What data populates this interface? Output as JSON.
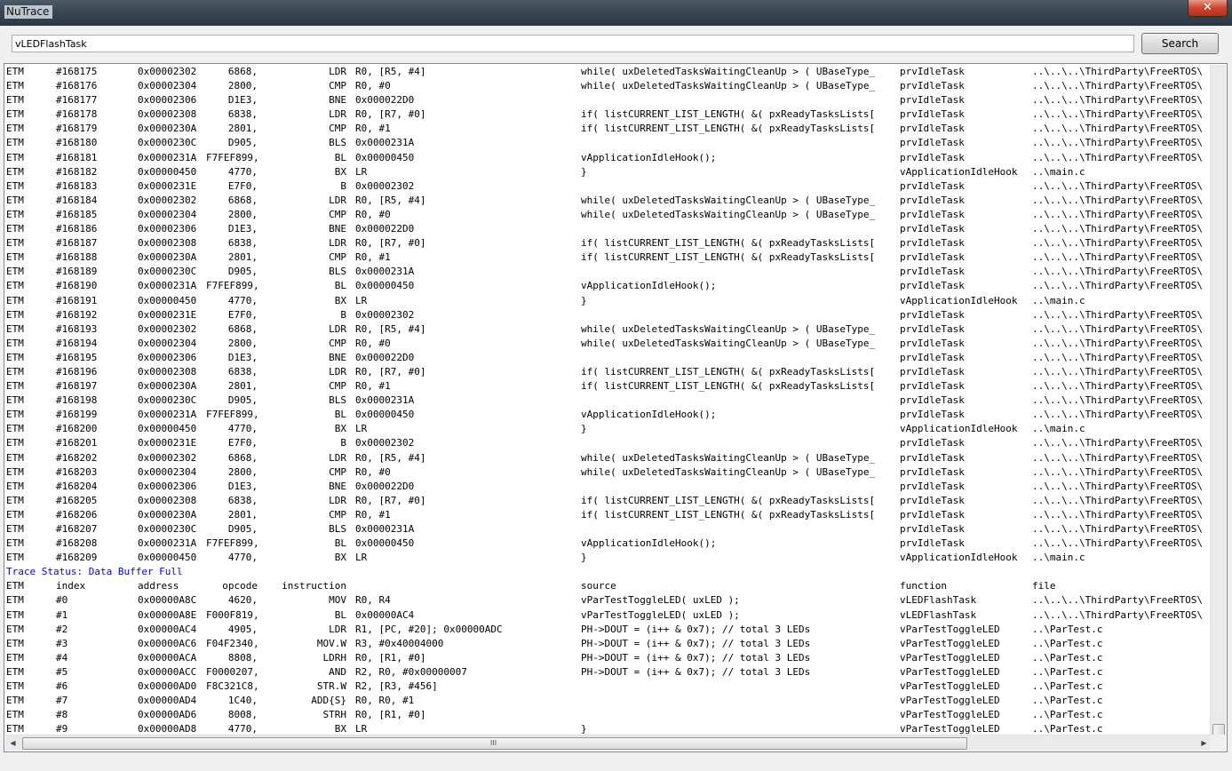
{
  "window": {
    "title": "NuTrace",
    "close_glyph": "✕"
  },
  "search": {
    "value": "vLEDFlashTask",
    "button_label": "Search"
  },
  "rows_top": [
    [
      "ETM",
      "#168175",
      "0x00002302",
      "6868,",
      "LDR",
      "R0, [R5, #4]",
      "while( uxDeletedTasksWaitingCleanUp > ( UBaseType_",
      "prvIdleTask",
      "..\\..\\..\\ThirdParty\\FreeRTOS\\"
    ],
    [
      "ETM",
      "#168176",
      "0x00002304",
      "2800,",
      "CMP",
      "R0, #0",
      "while( uxDeletedTasksWaitingCleanUp > ( UBaseType_",
      "prvIdleTask",
      "..\\..\\..\\ThirdParty\\FreeRTOS\\"
    ],
    [
      "ETM",
      "#168177",
      "0x00002306",
      "D1E3,",
      "BNE",
      "0x000022D0",
      "",
      "prvIdleTask",
      "..\\..\\..\\ThirdParty\\FreeRTOS\\"
    ],
    [
      "ETM",
      "#168178",
      "0x00002308",
      "6838,",
      "LDR",
      "R0, [R7, #0]",
      "if( listCURRENT_LIST_LENGTH( &( pxReadyTasksLists[",
      "prvIdleTask",
      "..\\..\\..\\ThirdParty\\FreeRTOS\\"
    ],
    [
      "ETM",
      "#168179",
      "0x0000230A",
      "2801,",
      "CMP",
      "R0, #1",
      "if( listCURRENT_LIST_LENGTH( &( pxReadyTasksLists[",
      "prvIdleTask",
      "..\\..\\..\\ThirdParty\\FreeRTOS\\"
    ],
    [
      "ETM",
      "#168180",
      "0x0000230C",
      "D905,",
      "BLS",
      "0x0000231A",
      "",
      "prvIdleTask",
      "..\\..\\..\\ThirdParty\\FreeRTOS\\"
    ],
    [
      "ETM",
      "#168181",
      "0x0000231A",
      "F7FEF899,",
      "BL",
      "0x00000450",
      "vApplicationIdleHook();",
      "prvIdleTask",
      "..\\..\\..\\ThirdParty\\FreeRTOS\\"
    ],
    [
      "ETM",
      "#168182",
      "0x00000450",
      "4770,",
      "BX",
      "LR",
      "}",
      "vApplicationIdleHook",
      "..\\main.c"
    ],
    [
      "ETM",
      "#168183",
      "0x0000231E",
      "E7F0,",
      "B",
      "0x00002302",
      "",
      "prvIdleTask",
      "..\\..\\..\\ThirdParty\\FreeRTOS\\"
    ],
    [
      "ETM",
      "#168184",
      "0x00002302",
      "6868,",
      "LDR",
      "R0, [R5, #4]",
      "while( uxDeletedTasksWaitingCleanUp > ( UBaseType_",
      "prvIdleTask",
      "..\\..\\..\\ThirdParty\\FreeRTOS\\"
    ],
    [
      "ETM",
      "#168185",
      "0x00002304",
      "2800,",
      "CMP",
      "R0, #0",
      "while( uxDeletedTasksWaitingCleanUp > ( UBaseType_",
      "prvIdleTask",
      "..\\..\\..\\ThirdParty\\FreeRTOS\\"
    ],
    [
      "ETM",
      "#168186",
      "0x00002306",
      "D1E3,",
      "BNE",
      "0x000022D0",
      "",
      "prvIdleTask",
      "..\\..\\..\\ThirdParty\\FreeRTOS\\"
    ],
    [
      "ETM",
      "#168187",
      "0x00002308",
      "6838,",
      "LDR",
      "R0, [R7, #0]",
      "if( listCURRENT_LIST_LENGTH( &( pxReadyTasksLists[",
      "prvIdleTask",
      "..\\..\\..\\ThirdParty\\FreeRTOS\\"
    ],
    [
      "ETM",
      "#168188",
      "0x0000230A",
      "2801,",
      "CMP",
      "R0, #1",
      "if( listCURRENT_LIST_LENGTH( &( pxReadyTasksLists[",
      "prvIdleTask",
      "..\\..\\..\\ThirdParty\\FreeRTOS\\"
    ],
    [
      "ETM",
      "#168189",
      "0x0000230C",
      "D905,",
      "BLS",
      "0x0000231A",
      "",
      "prvIdleTask",
      "..\\..\\..\\ThirdParty\\FreeRTOS\\"
    ],
    [
      "ETM",
      "#168190",
      "0x0000231A",
      "F7FEF899,",
      "BL",
      "0x00000450",
      "vApplicationIdleHook();",
      "prvIdleTask",
      "..\\..\\..\\ThirdParty\\FreeRTOS\\"
    ],
    [
      "ETM",
      "#168191",
      "0x00000450",
      "4770,",
      "BX",
      "LR",
      "}",
      "vApplicationIdleHook",
      "..\\main.c"
    ],
    [
      "ETM",
      "#168192",
      "0x0000231E",
      "E7F0,",
      "B",
      "0x00002302",
      "",
      "prvIdleTask",
      "..\\..\\..\\ThirdParty\\FreeRTOS\\"
    ],
    [
      "ETM",
      "#168193",
      "0x00002302",
      "6868,",
      "LDR",
      "R0, [R5, #4]",
      "while( uxDeletedTasksWaitingCleanUp > ( UBaseType_",
      "prvIdleTask",
      "..\\..\\..\\ThirdParty\\FreeRTOS\\"
    ],
    [
      "ETM",
      "#168194",
      "0x00002304",
      "2800,",
      "CMP",
      "R0, #0",
      "while( uxDeletedTasksWaitingCleanUp > ( UBaseType_",
      "prvIdleTask",
      "..\\..\\..\\ThirdParty\\FreeRTOS\\"
    ],
    [
      "ETM",
      "#168195",
      "0x00002306",
      "D1E3,",
      "BNE",
      "0x000022D0",
      "",
      "prvIdleTask",
      "..\\..\\..\\ThirdParty\\FreeRTOS\\"
    ],
    [
      "ETM",
      "#168196",
      "0x00002308",
      "6838,",
      "LDR",
      "R0, [R7, #0]",
      "if( listCURRENT_LIST_LENGTH( &( pxReadyTasksLists[",
      "prvIdleTask",
      "..\\..\\..\\ThirdParty\\FreeRTOS\\"
    ],
    [
      "ETM",
      "#168197",
      "0x0000230A",
      "2801,",
      "CMP",
      "R0, #1",
      "if( listCURRENT_LIST_LENGTH( &( pxReadyTasksLists[",
      "prvIdleTask",
      "..\\..\\..\\ThirdParty\\FreeRTOS\\"
    ],
    [
      "ETM",
      "#168198",
      "0x0000230C",
      "D905,",
      "BLS",
      "0x0000231A",
      "",
      "prvIdleTask",
      "..\\..\\..\\ThirdParty\\FreeRTOS\\"
    ],
    [
      "ETM",
      "#168199",
      "0x0000231A",
      "F7FEF899,",
      "BL",
      "0x00000450",
      "vApplicationIdleHook();",
      "prvIdleTask",
      "..\\..\\..\\ThirdParty\\FreeRTOS\\"
    ],
    [
      "ETM",
      "#168200",
      "0x00000450",
      "4770,",
      "BX",
      "LR",
      "}",
      "vApplicationIdleHook",
      "..\\main.c"
    ],
    [
      "ETM",
      "#168201",
      "0x0000231E",
      "E7F0,",
      "B",
      "0x00002302",
      "",
      "prvIdleTask",
      "..\\..\\..\\ThirdParty\\FreeRTOS\\"
    ],
    [
      "ETM",
      "#168202",
      "0x00002302",
      "6868,",
      "LDR",
      "R0, [R5, #4]",
      "while( uxDeletedTasksWaitingCleanUp > ( UBaseType_",
      "prvIdleTask",
      "..\\..\\..\\ThirdParty\\FreeRTOS\\"
    ],
    [
      "ETM",
      "#168203",
      "0x00002304",
      "2800,",
      "CMP",
      "R0, #0",
      "while( uxDeletedTasksWaitingCleanUp > ( UBaseType_",
      "prvIdleTask",
      "..\\..\\..\\ThirdParty\\FreeRTOS\\"
    ],
    [
      "ETM",
      "#168204",
      "0x00002306",
      "D1E3,",
      "BNE",
      "0x000022D0",
      "",
      "prvIdleTask",
      "..\\..\\..\\ThirdParty\\FreeRTOS\\"
    ],
    [
      "ETM",
      "#168205",
      "0x00002308",
      "6838,",
      "LDR",
      "R0, [R7, #0]",
      "if( listCURRENT_LIST_LENGTH( &( pxReadyTasksLists[",
      "prvIdleTask",
      "..\\..\\..\\ThirdParty\\FreeRTOS\\"
    ],
    [
      "ETM",
      "#168206",
      "0x0000230A",
      "2801,",
      "CMP",
      "R0, #1",
      "if( listCURRENT_LIST_LENGTH( &( pxReadyTasksLists[",
      "prvIdleTask",
      "..\\..\\..\\ThirdParty\\FreeRTOS\\"
    ],
    [
      "ETM",
      "#168207",
      "0x0000230C",
      "D905,",
      "BLS",
      "0x0000231A",
      "",
      "prvIdleTask",
      "..\\..\\..\\ThirdParty\\FreeRTOS\\"
    ],
    [
      "ETM",
      "#168208",
      "0x0000231A",
      "F7FEF899,",
      "BL",
      "0x00000450",
      "vApplicationIdleHook();",
      "prvIdleTask",
      "..\\..\\..\\ThirdParty\\FreeRTOS\\"
    ],
    [
      "ETM",
      "#168209",
      "0x00000450",
      "4770,",
      "BX",
      "LR",
      "}",
      "vApplicationIdleHook",
      "..\\main.c"
    ]
  ],
  "status": {
    "text": "Trace Status: Data Buffer Full",
    "color": "#0000ff"
  },
  "header_row": [
    "ETM",
    "index",
    "address",
    "opcode",
    "instruction",
    "",
    "source",
    "function",
    "file"
  ],
  "rows_bottom": [
    [
      "ETM",
      "#0",
      "0x00000A8C",
      "4620,",
      "MOV",
      "R0, R4",
      "vParTestToggleLED( uxLED );",
      "vLEDFlashTask",
      "..\\..\\..\\ThirdParty\\FreeRTOS\\"
    ],
    [
      "ETM",
      "#1",
      "0x00000A8E",
      "F000F819,",
      "BL",
      "0x00000AC4",
      "vParTestToggleLED( uxLED );",
      "vLEDFlashTask",
      "..\\..\\..\\ThirdParty\\FreeRTOS\\"
    ],
    [
      "ETM",
      "#2",
      "0x00000AC4",
      "4905,",
      "LDR",
      "R1, [PC, #20]; 0x00000ADC",
      "PH->DOUT = (i++ & 0x7); // total 3 LEDs",
      "vParTestToggleLED",
      "..\\ParTest.c"
    ],
    [
      "ETM",
      "#3",
      "0x00000AC6",
      "F04F2340,",
      "MOV.W",
      "R3, #0x40004000",
      "PH->DOUT = (i++ & 0x7); // total 3 LEDs",
      "vParTestToggleLED",
      "..\\ParTest.c"
    ],
    [
      "ETM",
      "#4",
      "0x00000ACA",
      "8808,",
      "LDRH",
      "R0, [R1, #0]",
      "PH->DOUT = (i++ & 0x7); // total 3 LEDs",
      "vParTestToggleLED",
      "..\\ParTest.c"
    ],
    [
      "ETM",
      "#5",
      "0x00000ACC",
      "F0000207,",
      "AND",
      "R2, R0, #0x00000007",
      "PH->DOUT = (i++ & 0x7); // total 3 LEDs",
      "vParTestToggleLED",
      "..\\ParTest.c"
    ],
    [
      "ETM",
      "#6",
      "0x00000AD0",
      "F8C321C8,",
      "STR.W",
      "R2, [R3, #456]",
      "",
      "vParTestToggleLED",
      "..\\ParTest.c"
    ],
    [
      "ETM",
      "#7",
      "0x00000AD4",
      "1C40,",
      "ADD{S}",
      "R0, R0, #1",
      "",
      "vParTestToggleLED",
      "..\\ParTest.c"
    ],
    [
      "ETM",
      "#8",
      "0x00000AD6",
      "8008,",
      "STRH",
      "R0, [R1, #0]",
      "",
      "vParTestToggleLED",
      "..\\ParTest.c"
    ],
    [
      "ETM",
      "#9",
      "0x00000AD8",
      "4770,",
      "BX",
      "LR",
      "}",
      "vParTestToggleLED",
      "..\\ParTest.c"
    ]
  ],
  "scrollbar": {
    "grip": "III",
    "left_arrow": "◀",
    "right_arrow": "▶"
  }
}
